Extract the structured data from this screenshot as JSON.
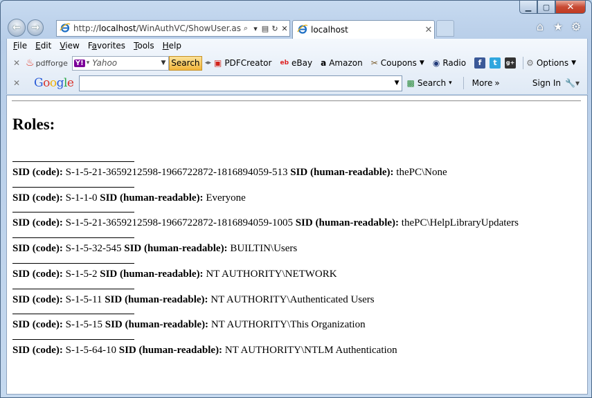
{
  "window": {
    "caption_buttons": [
      "minimize",
      "maximize",
      "close"
    ],
    "nav": {
      "address_prefix": "http://",
      "address_host": "localhost",
      "address_path": "/WinAuthVC/ShowUser.asp",
      "tab_title": "localhost",
      "icons": [
        "back-arrow-icon",
        "forward-arrow-icon",
        "ie-icon",
        "search-icon",
        "compat-icon",
        "refresh-icon",
        "close-icon",
        "home-icon",
        "favorites-star-icon",
        "gear-icon"
      ]
    },
    "menu": [
      {
        "label": "File",
        "key": "F"
      },
      {
        "label": "Edit",
        "key": "E"
      },
      {
        "label": "View",
        "key": "V"
      },
      {
        "label": "Favorites",
        "key": "a"
      },
      {
        "label": "Tools",
        "key": "T"
      },
      {
        "label": "Help",
        "key": "H"
      }
    ],
    "toolbar1": {
      "pdfforge": "pdfforge",
      "yahoo_placeholder": "Yahoo",
      "search_button": "Search",
      "items": [
        "PDFCreator",
        "eBay",
        "Amazon",
        "Coupons",
        "Radio"
      ],
      "social": [
        "f",
        "t",
        "g+"
      ],
      "options": "Options"
    },
    "toolbar2": {
      "google": "Google",
      "search": "Search",
      "more": "More",
      "sign_in": "Sign In"
    }
  },
  "page": {
    "title": "Roles:",
    "code_label": "SID (code):",
    "readable_label": "SID (human-readable):",
    "roles": [
      {
        "code": "S-1-5-21-3659212598-1966722872-1816894059-513",
        "readable": "thePC\\None"
      },
      {
        "code": "S-1-1-0",
        "readable": "Everyone"
      },
      {
        "code": "S-1-5-21-3659212598-1966722872-1816894059-1005",
        "readable": "thePC\\HelpLibraryUpdaters"
      },
      {
        "code": "S-1-5-32-545",
        "readable": "BUILTIN\\Users"
      },
      {
        "code": "S-1-5-2",
        "readable": "NT AUTHORITY\\NETWORK"
      },
      {
        "code": "S-1-5-11",
        "readable": "NT AUTHORITY\\Authenticated Users"
      },
      {
        "code": "S-1-5-15",
        "readable": "NT AUTHORITY\\This Organization"
      },
      {
        "code": "S-1-5-64-10",
        "readable": "NT AUTHORITY\\NTLM Authentication"
      }
    ]
  }
}
